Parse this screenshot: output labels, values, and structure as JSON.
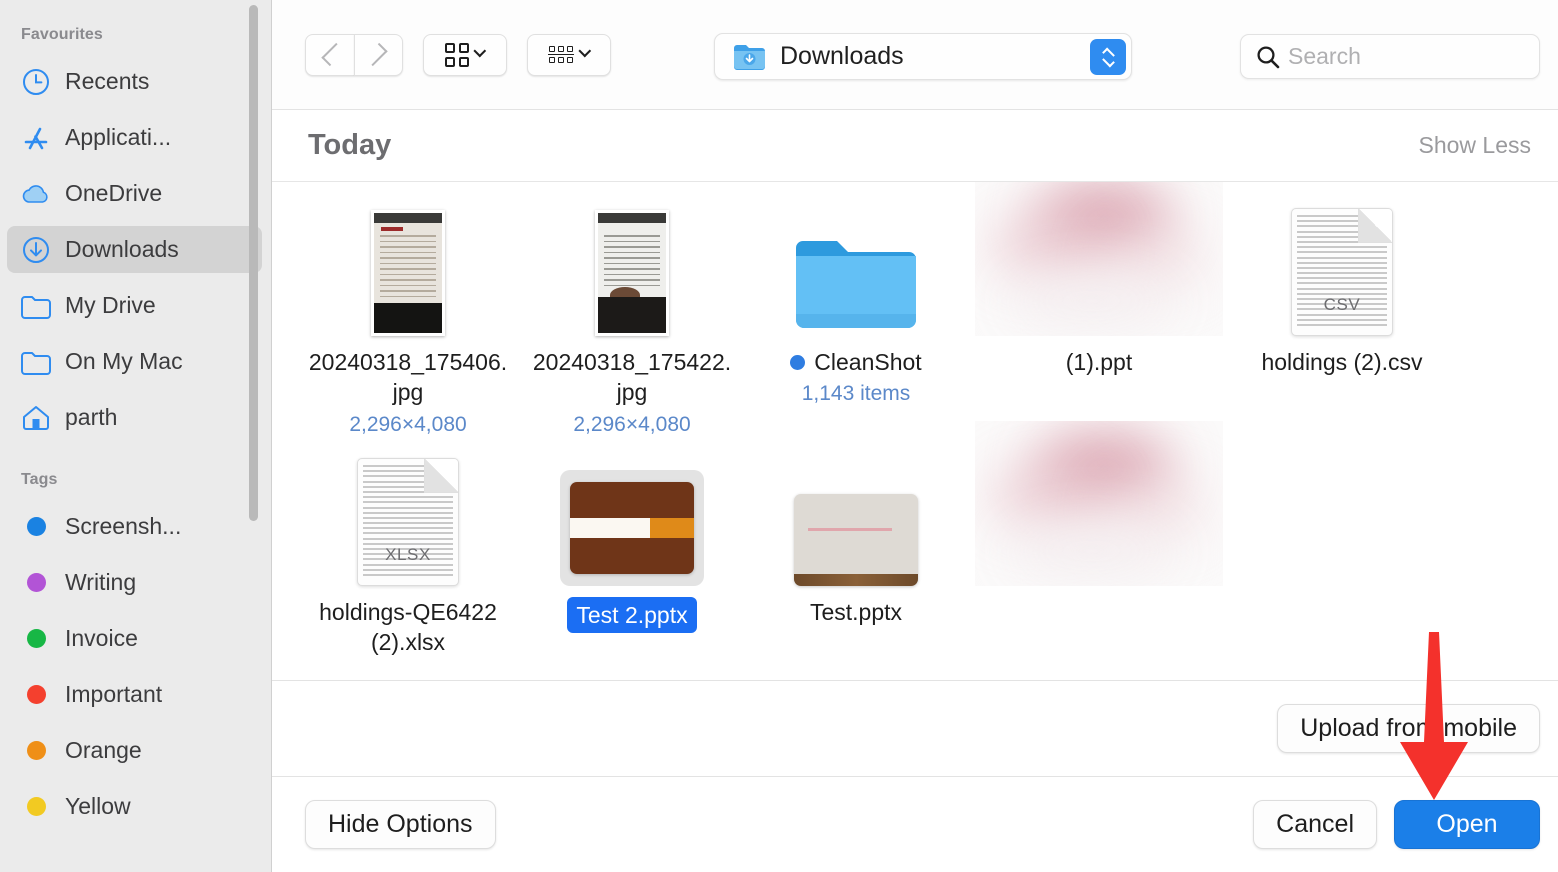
{
  "sidebar": {
    "favourites_title": "Favourites",
    "favourites": [
      {
        "label": "Recents",
        "icon": "clock-icon",
        "selected": false
      },
      {
        "label": "Applicati...",
        "icon": "app-store-icon",
        "selected": false
      },
      {
        "label": "OneDrive",
        "icon": "cloud-icon",
        "selected": false
      },
      {
        "label": "Downloads",
        "icon": "download-icon",
        "selected": true
      },
      {
        "label": "My Drive",
        "icon": "folder-icon",
        "selected": false
      },
      {
        "label": "On My Mac",
        "icon": "folder-icon",
        "selected": false
      },
      {
        "label": "parth",
        "icon": "home-icon",
        "selected": false
      }
    ],
    "tags_title": "Tags",
    "tags": [
      {
        "label": "Screensh...",
        "color": "#1a82e2"
      },
      {
        "label": "Writing",
        "color": "#b254d6"
      },
      {
        "label": "Invoice",
        "color": "#17b745"
      },
      {
        "label": "Important",
        "color": "#f4402e"
      },
      {
        "label": "Orange",
        "color": "#ef8f17"
      },
      {
        "label": "Yellow",
        "color": "#f2ca22"
      }
    ]
  },
  "toolbar": {
    "back_label": "Back",
    "forward_label": "Forward",
    "icon_view_label": "Icon View",
    "group_view_label": "Group By",
    "path_label": "Downloads",
    "search_placeholder": "Search",
    "search_value": ""
  },
  "group": {
    "title": "Today",
    "show_less_label": "Show Less"
  },
  "files": {
    "row1": [
      {
        "name": "20240318_175406.jpg",
        "meta": "2,296×4,080",
        "kind": "photo-portrait",
        "selected": false,
        "tag_dot": null
      },
      {
        "name": "20240318_175422.jpg",
        "meta": "2,296×4,080",
        "kind": "photo-notes",
        "selected": false,
        "tag_dot": null
      },
      {
        "name": "CleanShot",
        "meta": "1,143 items",
        "kind": "folder",
        "selected": false,
        "tag_dot": "#2f7de1"
      },
      {
        "name": "(1).ppt",
        "meta": "",
        "kind": "blurred",
        "selected": false,
        "tag_dot": null
      },
      {
        "name": "holdings (2).csv",
        "meta": "",
        "kind": "doc-csv",
        "selected": false,
        "tag_dot": null,
        "ext": "CSV"
      }
    ],
    "row2": [
      {
        "name": "holdings-QE6422 (2).xlsx",
        "meta": "",
        "kind": "doc-xlsx",
        "selected": false,
        "tag_dot": null,
        "ext": "XLSX"
      },
      {
        "name": "Test 2.pptx",
        "meta": "",
        "kind": "slide-brown",
        "selected": true,
        "tag_dot": null
      },
      {
        "name": "Test.pptx",
        "meta": "",
        "kind": "slide-white",
        "selected": false,
        "tag_dot": null
      },
      {
        "name": "",
        "meta": "",
        "kind": "blurred",
        "selected": false,
        "tag_dot": null
      }
    ]
  },
  "options": {
    "upload_from_mobile_label": "Upload from mobile"
  },
  "footer": {
    "hide_options_label": "Hide Options",
    "cancel_label": "Cancel",
    "open_label": "Open"
  },
  "annotation": {
    "arrow_color": "#f4312c",
    "points_to": "Open"
  }
}
